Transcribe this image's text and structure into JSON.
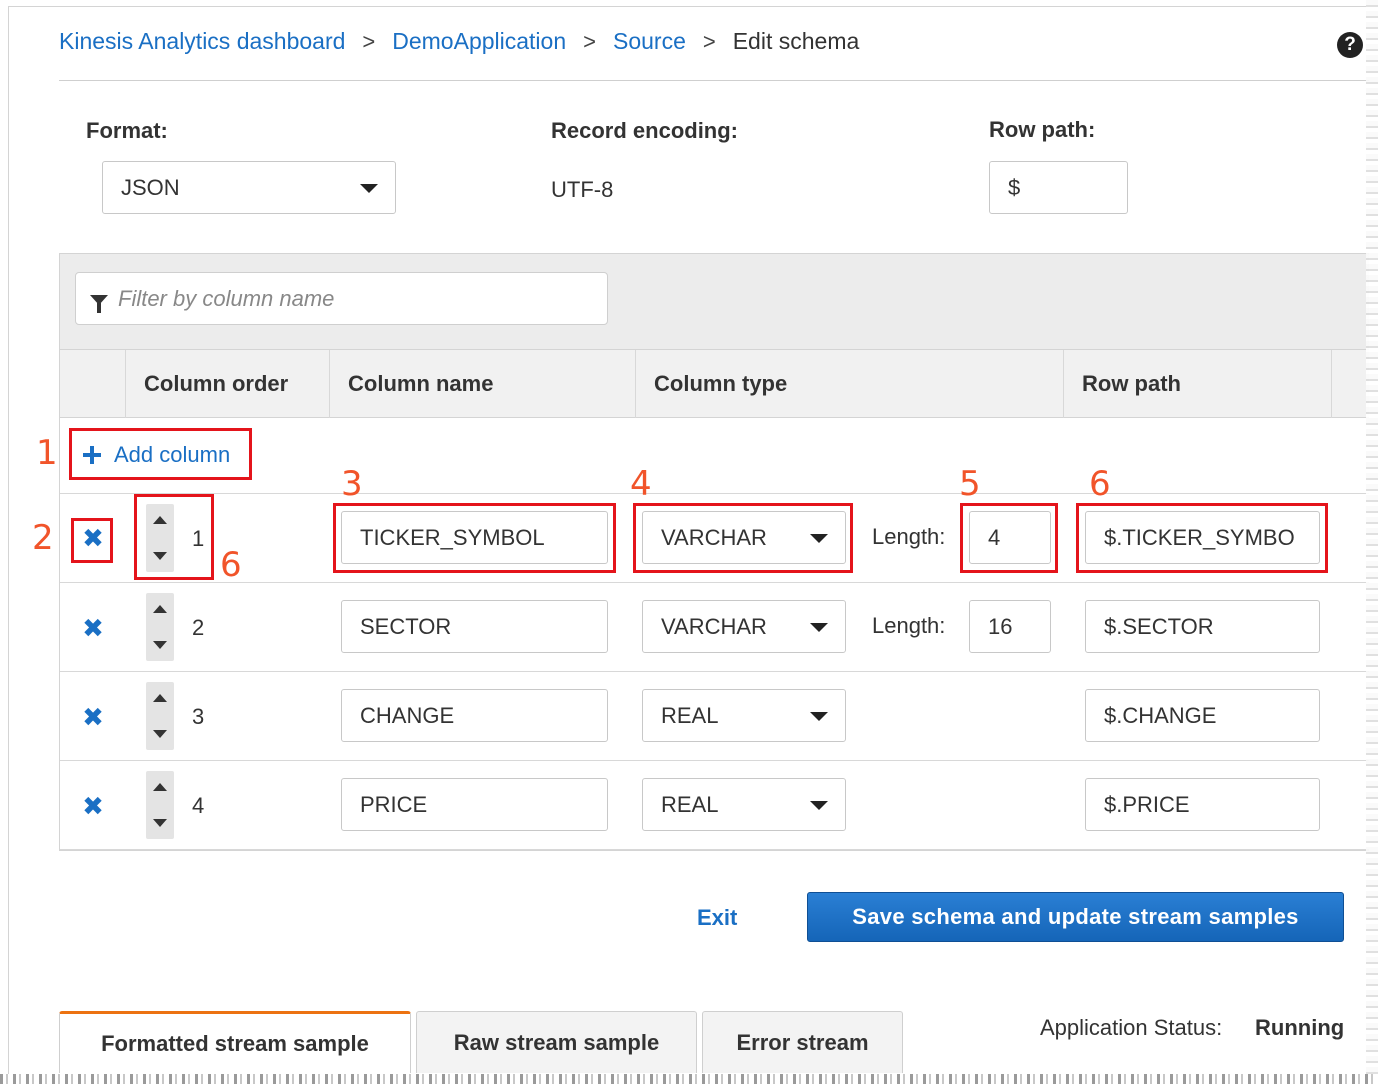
{
  "breadcrumb": {
    "items": [
      "Kinesis Analytics dashboard",
      "DemoApplication",
      "Source"
    ],
    "current": "Edit schema",
    "separator": ">"
  },
  "help_icon": "question-circle-icon",
  "format": {
    "label": "Format:",
    "value": "JSON"
  },
  "record_encoding": {
    "label": "Record encoding:",
    "value": "UTF-8"
  },
  "row_path_field": {
    "label": "Row path:",
    "value": "$"
  },
  "filter": {
    "placeholder": "Filter by column name"
  },
  "table": {
    "headers": [
      "Column order",
      "Column name",
      "Column type",
      "Row path"
    ],
    "add_column_label": "Add column",
    "length_label": "Length:",
    "rows": [
      {
        "order": "1",
        "name": "TICKER_SYMBOL",
        "type": "VARCHAR",
        "length": "4",
        "row_path": "$.TICKER_SYMBO"
      },
      {
        "order": "2",
        "name": "SECTOR",
        "type": "VARCHAR",
        "length": "16",
        "row_path": "$.SECTOR"
      },
      {
        "order": "3",
        "name": "CHANGE",
        "type": "REAL",
        "length": "",
        "row_path": "$.CHANGE"
      },
      {
        "order": "4",
        "name": "PRICE",
        "type": "REAL",
        "length": "",
        "row_path": "$.PRICE"
      }
    ]
  },
  "annotations": [
    "1",
    "2",
    "3",
    "4",
    "5",
    "6",
    "6"
  ],
  "actions": {
    "exit_label": "Exit",
    "save_label": "Save schema and update stream samples"
  },
  "tabs": [
    {
      "label": "Formatted stream sample",
      "active": true
    },
    {
      "label": "Raw stream sample",
      "active": false
    },
    {
      "label": "Error stream",
      "active": false
    }
  ],
  "status": {
    "label": "Application Status:",
    "value": "Running"
  },
  "colors": {
    "link": "#1a6fc4",
    "annotation_red": "#e4141b",
    "annotation_number": "#f1542a",
    "primary_button": "#1565b8",
    "active_tab_accent": "#ec7211"
  }
}
